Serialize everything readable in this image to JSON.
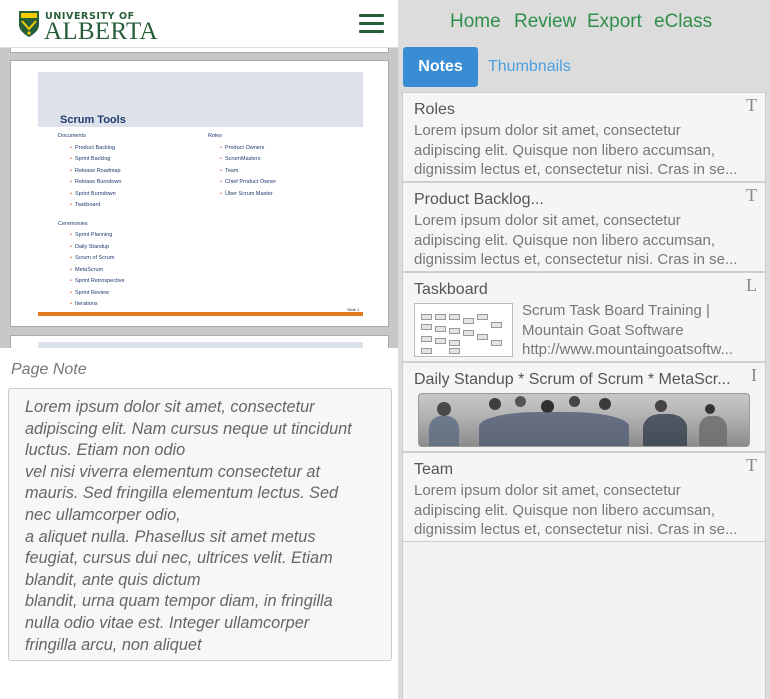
{
  "header": {
    "logo_top": "UNIVERSITY OF",
    "logo_bottom": "ALBERTA"
  },
  "slide": {
    "title": "Scrum Tools",
    "documents_head": "Documents",
    "documents": [
      "Product Backlog",
      "Sprint Backlog",
      "Release Roadmap",
      "Release Burndown",
      "Sprint Burndown",
      "Taskboard"
    ],
    "ceremonies_head": "Ceremonies",
    "ceremonies": [
      "Sprint Planning",
      "Daily Standup",
      "Scrum of Scrum",
      "MetaScrum",
      "Sprint Retrospective",
      "Sprint Review",
      "Iterations"
    ],
    "roles_head": "Roles",
    "roles": [
      "Product Owners",
      "ScrumMasters",
      "Team",
      "Chief Product Owner",
      "Über Scrum Master"
    ],
    "footer_label": "Slide 1"
  },
  "page_note": {
    "label": "Page Note",
    "lines": [
      "Lorem ipsum dolor sit amet, consectetur",
      "adipiscing elit. Nam cursus neque ut tincidunt",
      "luctus. Etiam non odio",
      "vel nisi viverra elementum consectetur at",
      "mauris. Sed fringilla elementum lectus. Sed",
      "nec ullamcorper odio,",
      "a aliquet nulla. Phasellus sit amet metus",
      "feugiat, cursus dui nec, ultrices velit. Etiam",
      "blandit, ante quis dictum",
      "blandit, urna quam tempor diam, in fringilla",
      "nulla odio vitae est. Integer ullamcorper",
      "fringilla arcu, non aliquet"
    ]
  },
  "nav": {
    "home": "Home",
    "review": "Review",
    "export": "Export",
    "eclass": "eClass"
  },
  "tabs": {
    "notes": "Notes",
    "thumbnails": "Thumbnails"
  },
  "notes": [
    {
      "title": "Roles",
      "type_icon": "T",
      "lines": [
        "Lorem ipsum dolor sit amet, consectetur",
        "adipiscing elit. Quisque non libero accumsan,",
        "dignissim lectus et, consectetur nisi. Cras in se..."
      ]
    },
    {
      "title": "Product Backlog...",
      "type_icon": "T",
      "lines": [
        "Lorem ipsum dolor sit amet, consectetur",
        "adipiscing elit. Quisque non libero accumsan,",
        "dignissim lectus et, consectetur nisi. Cras in se..."
      ]
    },
    {
      "title": "Taskboard",
      "type_icon": "L",
      "link_lines": [
        "Scrum Task Board Training  |",
        "Mountain Goat Software",
        "http://www.mountaingoatsoftw..."
      ]
    },
    {
      "title": "Daily Standup * Scrum of Scrum * MetaScr...",
      "type_icon": "I"
    },
    {
      "title": "Team",
      "type_icon": "T",
      "lines": [
        "Lorem ipsum dolor sit amet, consectetur",
        "adipiscing elit. Quisque non libero accumsan,",
        "dignissim lectus et, consectetur nisi. Cras in se..."
      ]
    }
  ],
  "colors": {
    "brand_green": "#275d38",
    "nav_green": "#2f8f4a",
    "tab_blue": "#3a8dd5",
    "link_blue": "#4aa0e0",
    "slide_accent": "#e07a1f"
  }
}
